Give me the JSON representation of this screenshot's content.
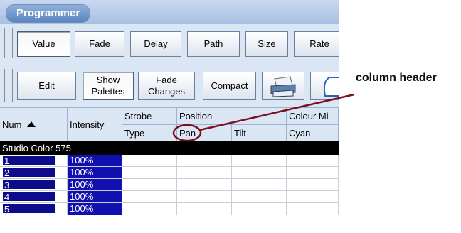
{
  "window": {
    "title": "Programmer"
  },
  "toolbar1": {
    "buttons": [
      "Value",
      "Fade",
      "Delay",
      "Path",
      "Size",
      "Rate"
    ]
  },
  "toolbar2": {
    "edit": "Edit",
    "show_palettes": [
      "Show",
      "Palettes"
    ],
    "fade_changes": [
      "Fade",
      "Changes"
    ],
    "compact": "Compact"
  },
  "grid": {
    "headers": {
      "num": "Num",
      "intensity": "Intensity",
      "strobe": "Strobe",
      "strobe_sub": "Type",
      "position": "Position",
      "pan": "Pan",
      "tilt": "Tilt",
      "colour_mix": "Colour Mi",
      "cyan": "Cyan"
    },
    "group": "Studio Color 575",
    "rows": [
      {
        "num": "1",
        "intensity": "100%"
      },
      {
        "num": "2",
        "intensity": "100%"
      },
      {
        "num": "3",
        "intensity": "100%"
      },
      {
        "num": "4",
        "intensity": "100%"
      },
      {
        "num": "5",
        "intensity": "100%"
      }
    ]
  },
  "annotation": {
    "label": "column header",
    "color": "#7a1020"
  }
}
